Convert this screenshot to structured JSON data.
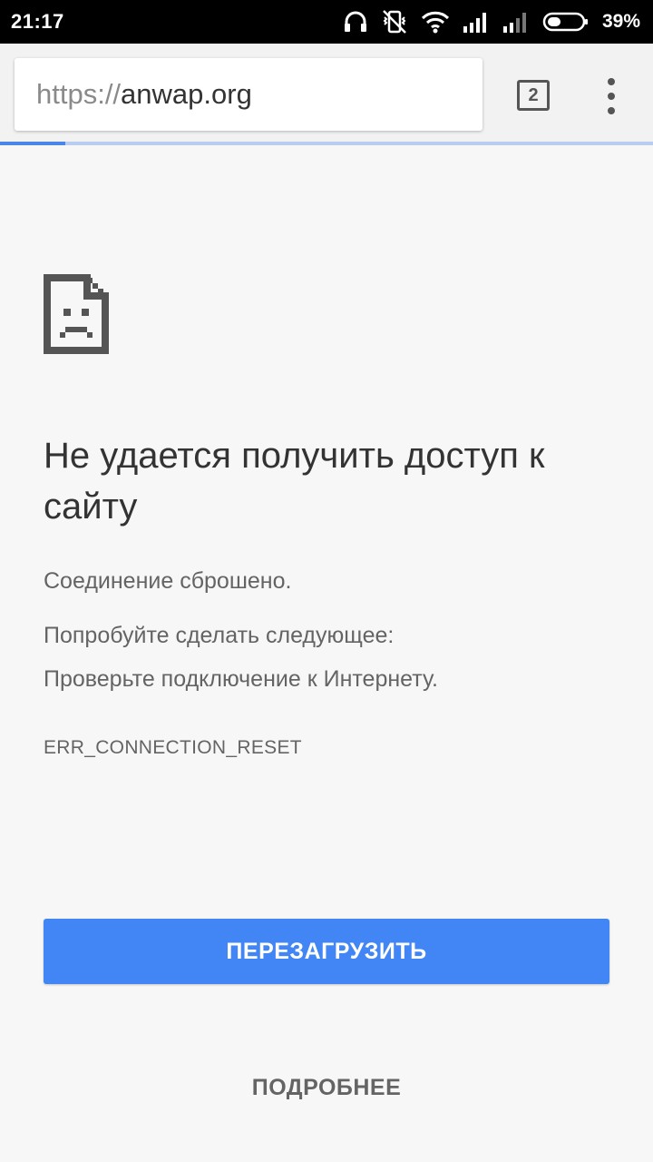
{
  "status_bar": {
    "time": "21:17",
    "battery_percent": "39%",
    "battery_level": 0.39,
    "icons": [
      "headphones-icon",
      "vibrate-off-icon",
      "wifi-icon",
      "signal-icon",
      "signal-icon",
      "battery-icon"
    ]
  },
  "toolbar": {
    "url_scheme": "https://",
    "url_host": "anwap.org",
    "tab_count": "2",
    "load_progress": 0.1
  },
  "error": {
    "icon": "sad-page-icon",
    "title": "Не удается получить доступ к сайту",
    "description": "Соединение сброшено.",
    "suggestions_heading": "Попробуйте сделать следующее:",
    "suggestion": "Проверьте подключение к Интернету.",
    "code": "ERR_CONNECTION_RESET"
  },
  "actions": {
    "reload_label": "ПЕРЕЗАГРУЗИТЬ",
    "details_label": "ПОДРОБНЕЕ"
  },
  "colors": {
    "accent": "#4285f4",
    "background": "#f7f7f7",
    "text_primary": "#333333",
    "text_secondary": "#646464"
  }
}
